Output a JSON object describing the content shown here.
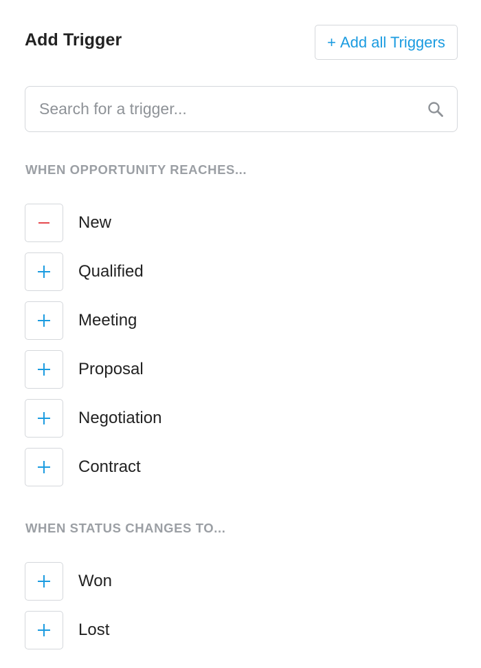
{
  "header": {
    "title": "Add Trigger",
    "add_all_plus": "+",
    "add_all_label": "Add all Triggers"
  },
  "search": {
    "placeholder": "Search for a trigger...",
    "value": ""
  },
  "sections": [
    {
      "heading": "WHEN OPPORTUNITY REACHES...",
      "items": [
        {
          "label": "New",
          "state": "added",
          "icon": "minus-icon"
        },
        {
          "label": "Qualified",
          "state": "available",
          "icon": "plus-icon"
        },
        {
          "label": "Meeting",
          "state": "available",
          "icon": "plus-icon"
        },
        {
          "label": "Proposal",
          "state": "available",
          "icon": "plus-icon"
        },
        {
          "label": "Negotiation",
          "state": "available",
          "icon": "plus-icon"
        },
        {
          "label": "Contract",
          "state": "available",
          "icon": "plus-icon"
        }
      ]
    },
    {
      "heading": "WHEN STATUS CHANGES TO...",
      "items": [
        {
          "label": "Won",
          "state": "available",
          "icon": "plus-icon"
        },
        {
          "label": "Lost",
          "state": "available",
          "icon": "plus-icon"
        }
      ]
    }
  ],
  "colors": {
    "accent": "#1a9be0",
    "remove": "#e5484d",
    "text": "#222222",
    "muted": "#9b9fa4",
    "border": "#d4d7db"
  }
}
